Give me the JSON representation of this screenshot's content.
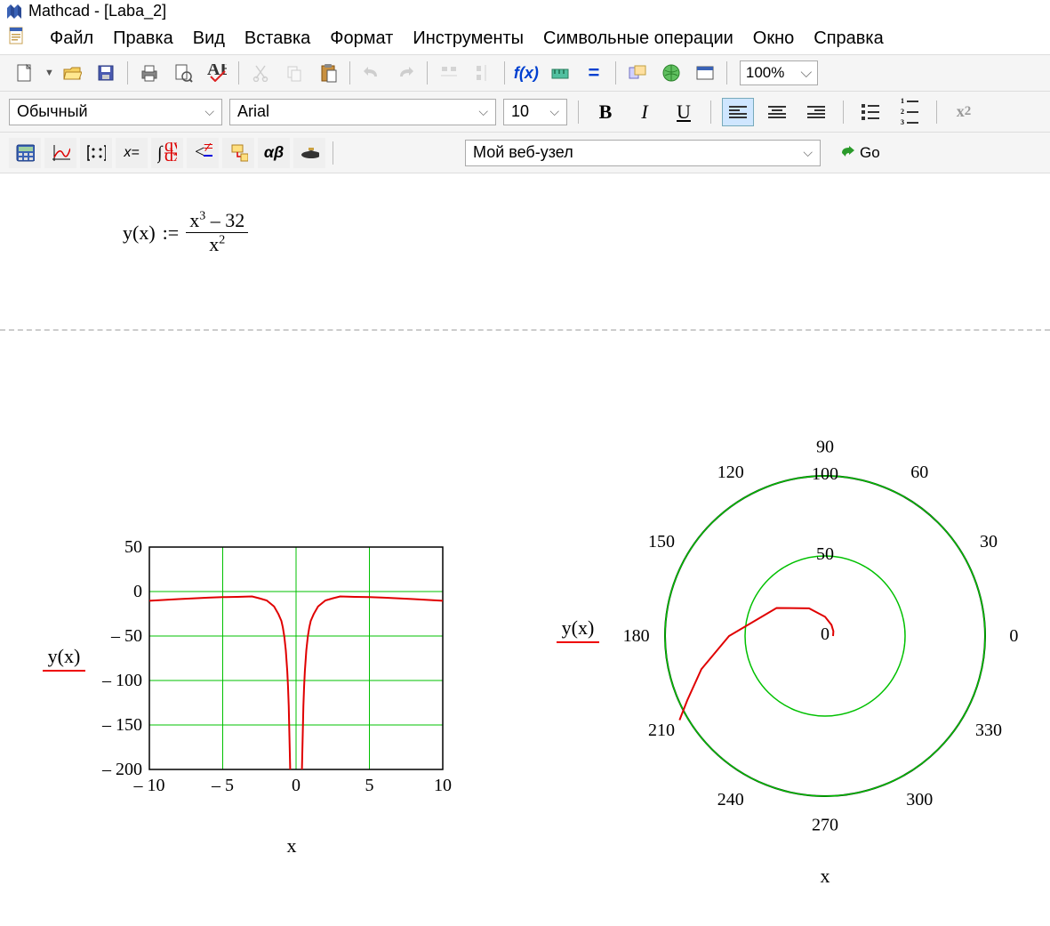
{
  "window": {
    "title": "Mathcad - [Laba_2]"
  },
  "menu": {
    "items": [
      "Файл",
      "Правка",
      "Вид",
      "Вставка",
      "Формат",
      "Инструменты",
      "Символьные операции",
      "Окно",
      "Справка"
    ]
  },
  "toolbar_main": {
    "zoom": "100%"
  },
  "format_bar": {
    "style": "Обычный",
    "font": "Arial",
    "size": "10"
  },
  "math_bar": {
    "web_combo": "Мой веб-узел",
    "go_label": "Go"
  },
  "formula": {
    "lhs": "y(x)",
    "assign": ":=",
    "num_base": "x",
    "num_exp": "3",
    "num_rest": "– 32",
    "den_base": "x",
    "den_exp": "2"
  },
  "chart_data": [
    {
      "type": "line",
      "title": "",
      "xlabel": "x",
      "ylabel": "y(x)",
      "xlim": [
        -10,
        10
      ],
      "ylim": [
        -200,
        50
      ],
      "xticks": [
        -10,
        -5,
        0,
        5,
        10
      ],
      "yticks": [
        50,
        0,
        -50,
        -100,
        -150,
        -200
      ],
      "grid": true,
      "series": [
        {
          "name": "y(x)",
          "color": "#e00000",
          "x": [
            -10,
            -8,
            -6,
            -5,
            -4,
            -3,
            -2.5,
            -2,
            -1.5,
            -1.2,
            -1,
            -0.9,
            -0.8,
            -0.7,
            -0.6,
            -0.55,
            -0.5,
            0.5,
            0.55,
            0.6,
            0.7,
            0.8,
            0.9,
            1,
            1.2,
            1.5,
            2,
            2.5,
            3,
            4,
            5,
            6,
            8,
            10
          ],
          "y": [
            -10.32,
            -8.5,
            -6.89,
            -6.28,
            -6,
            -5.56,
            -7.62,
            -10,
            -16.72,
            -25.42,
            -33,
            -40.41,
            -50.8,
            -65.98,
            -89.49,
            -106.16,
            -128.5,
            -128.5,
            -106.16,
            -89.49,
            -65.98,
            -50.8,
            -40.41,
            -33,
            -25.42,
            -16.72,
            -10,
            -7.62,
            -5.56,
            -6,
            -6.28,
            -6.89,
            -8.5,
            -10.32
          ]
        }
      ]
    },
    {
      "type": "polar",
      "xlabel": "x",
      "ylabel": "y(x)",
      "angle_ticks": [
        0,
        30,
        60,
        90,
        120,
        150,
        180,
        210,
        240,
        270,
        300,
        330
      ],
      "radial_ticks": [
        0,
        50,
        100
      ],
      "rmax": 100,
      "grid_circles": [
        50,
        100
      ],
      "series": [
        {
          "name": "y(x)",
          "color": "#e00000",
          "theta_deg": [
            0,
            30,
            60,
            90,
            120,
            150,
            180,
            195,
            205,
            210
          ],
          "r": [
            5,
            6,
            8,
            12,
            20,
            35,
            60,
            80,
            95,
            108
          ]
        }
      ]
    }
  ]
}
